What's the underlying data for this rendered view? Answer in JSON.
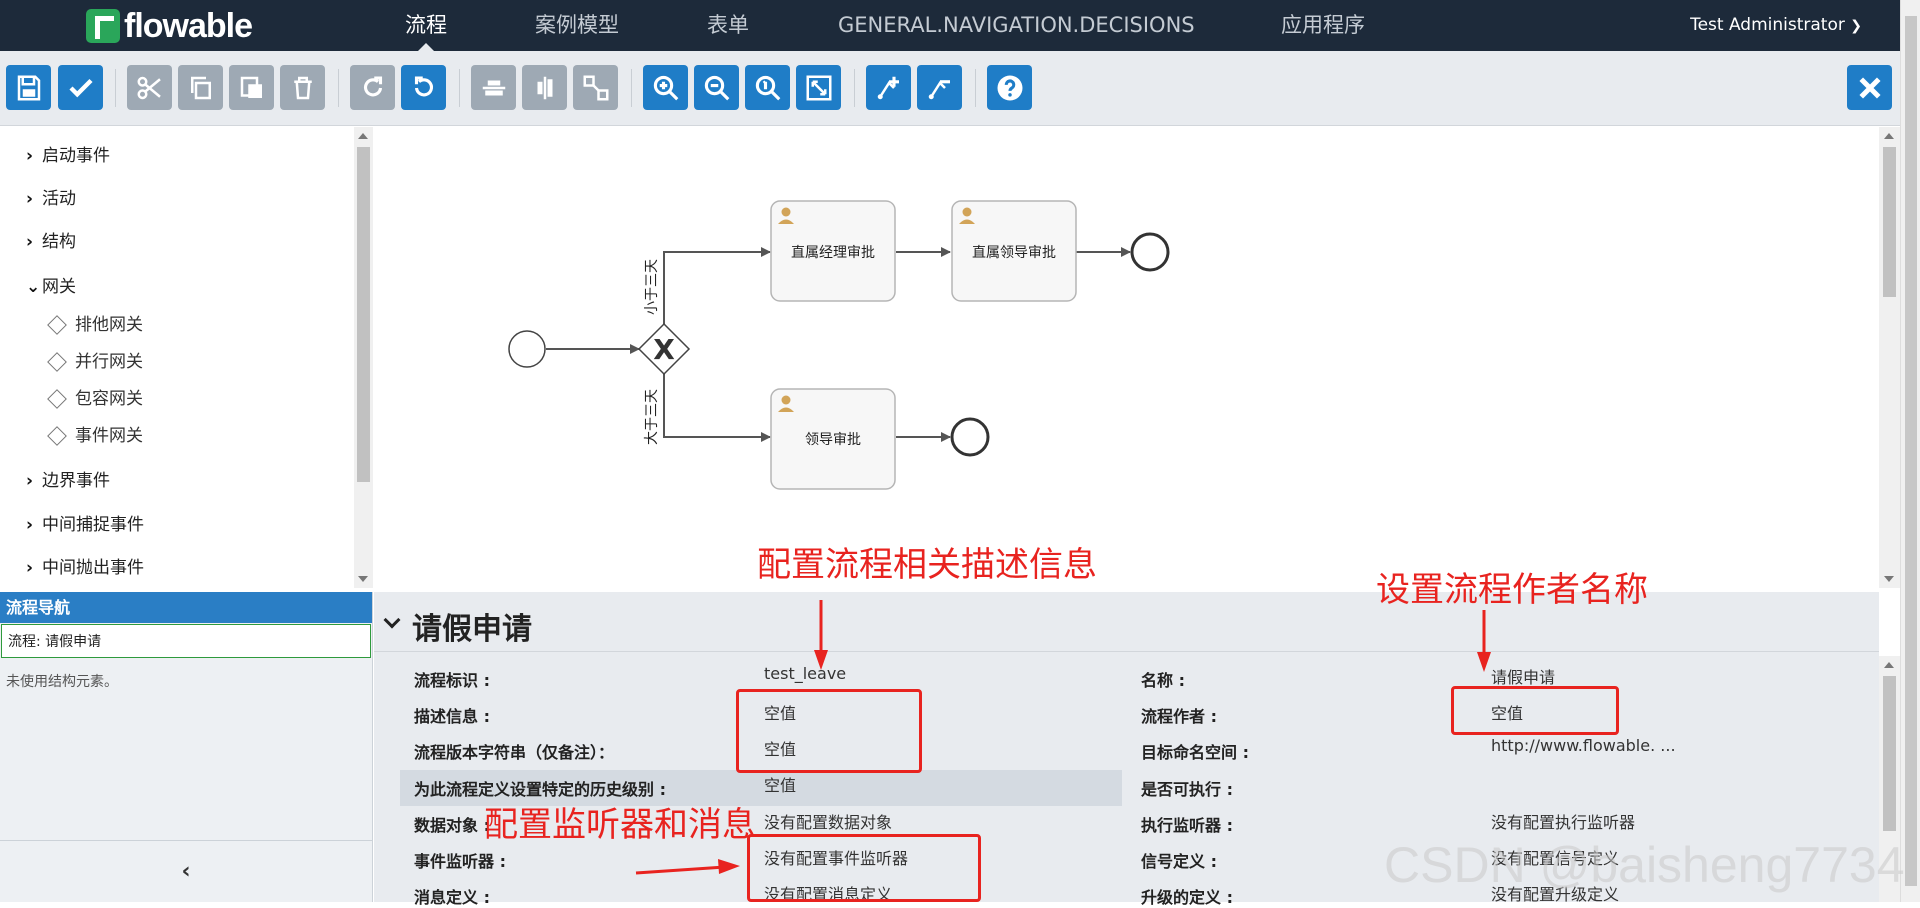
{
  "app": {
    "logo_text": "flowable",
    "nav": [
      "流程",
      "案例模型",
      "表单",
      "GENERAL.NAVIGATION.DECISIONS",
      "应用程序"
    ],
    "active_nav": "流程",
    "user": "Test Administrator"
  },
  "palette": {
    "groups": [
      {
        "label": "启动事件",
        "expanded": false
      },
      {
        "label": "活动",
        "expanded": false
      },
      {
        "label": "结构",
        "expanded": false
      },
      {
        "label": "网关",
        "expanded": true
      },
      {
        "label": "边界事件",
        "expanded": false
      },
      {
        "label": "中间捕捉事件",
        "expanded": false
      },
      {
        "label": "中间抛出事件",
        "expanded": false
      }
    ],
    "gateway_items": [
      "排他网关",
      "并行网关",
      "包容网关",
      "事件网关"
    ]
  },
  "navigator": {
    "title": "流程导航",
    "process": "流程: 请假申请",
    "unused": "未使用结构元素。",
    "collapse_glyph": "‹"
  },
  "diagram": {
    "tasks": [
      "直属经理审批",
      "直属领导审批",
      "领导审批"
    ],
    "flow_labels": [
      "小于三天",
      "大于三天"
    ],
    "gateway_glyph": "X"
  },
  "properties": {
    "title": "请假申请",
    "left": [
      {
        "label": "流程标识 :",
        "value": "test_leave"
      },
      {
        "label": "描述信息 :",
        "value": "空值"
      },
      {
        "label": "流程版本字符串（仅备注）：",
        "value": "空值"
      },
      {
        "label": "为此流程定义设置特定的历史级别 :",
        "value": "空值"
      },
      {
        "label": "数据对象 :",
        "value": "没有配置数据对象"
      },
      {
        "label": "事件监听器 :",
        "value": "没有配置事件监听器"
      },
      {
        "label": "消息定义 :",
        "value": "没有配置消息定义"
      }
    ],
    "right": [
      {
        "label": "名称 :",
        "value": "请假申请"
      },
      {
        "label": "流程作者 :",
        "value": "空值"
      },
      {
        "label": "目标命名空间 :",
        "value": "http://www.flowable. ..."
      },
      {
        "label": "是否可执行 :",
        "value": ""
      },
      {
        "label": "执行监听器 :",
        "value": "没有配置执行监听器"
      },
      {
        "label": "信号定义 :",
        "value": "没有配置信号定义"
      },
      {
        "label": "升级的定义 :",
        "value": "没有配置升级定义"
      }
    ]
  },
  "annotations": {
    "describe": "配置流程相关描述信息",
    "author": "设置流程作者名称",
    "listeners": "配置监听器和消息"
  },
  "watermark": "CSDN @baisheng7734",
  "colors": {
    "nav_bg": "#1d2a3a",
    "blue_button": "#1f7dc7",
    "gray_button": "#9ea9b4",
    "annotation": "#e8231f",
    "nav_head": "#2a7ec5"
  }
}
